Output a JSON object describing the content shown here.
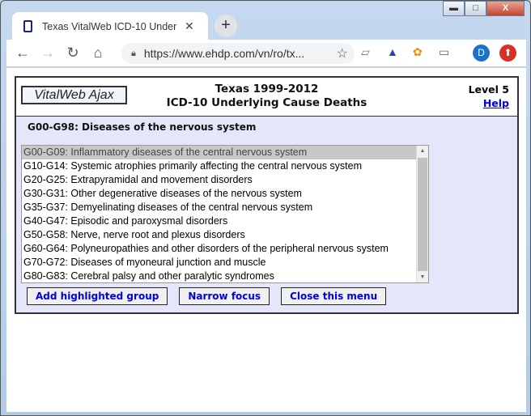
{
  "browser": {
    "tab_title": "Texas VitalWeb ICD-10 Underlying Cause Deaths",
    "url": "https://www.ehdp.com/vn/ro/tx...",
    "avatar_letter": "D"
  },
  "header": {
    "brand": "VitalWeb Ajax",
    "title_line1": "Texas 1999-2012",
    "title_line2": "ICD-10 Underlying Cause Deaths",
    "level": "Level 5",
    "help": "Help"
  },
  "panel": {
    "group": "G00-G98: Diseases of the nervous system",
    "items": [
      {
        "label": "G00-G09: Inflammatory diseases of the central nervous system",
        "selected": true
      },
      {
        "label": "G10-G14: Systemic atrophies primarily affecting the central nervous system"
      },
      {
        "label": "G20-G25: Extrapyramidal and movement disorders"
      },
      {
        "label": "G30-G31: Other degenerative diseases of the nervous system"
      },
      {
        "label": "G35-G37: Demyelinating diseases of the central nervous system"
      },
      {
        "label": "G40-G47: Episodic and paroxysmal disorders"
      },
      {
        "label": "G50-G58: Nerve, nerve root and plexus disorders"
      },
      {
        "label": "G60-G64: Polyneuropathies and other disorders of the peripheral nervous system"
      },
      {
        "label": "G70-G72: Diseases of myoneural junction and muscle"
      },
      {
        "label": "G80-G83: Cerebral palsy and other paralytic syndromes"
      }
    ],
    "buttons": {
      "add": "Add highlighted group",
      "narrow": "Narrow focus",
      "close": "Close this menu"
    }
  }
}
